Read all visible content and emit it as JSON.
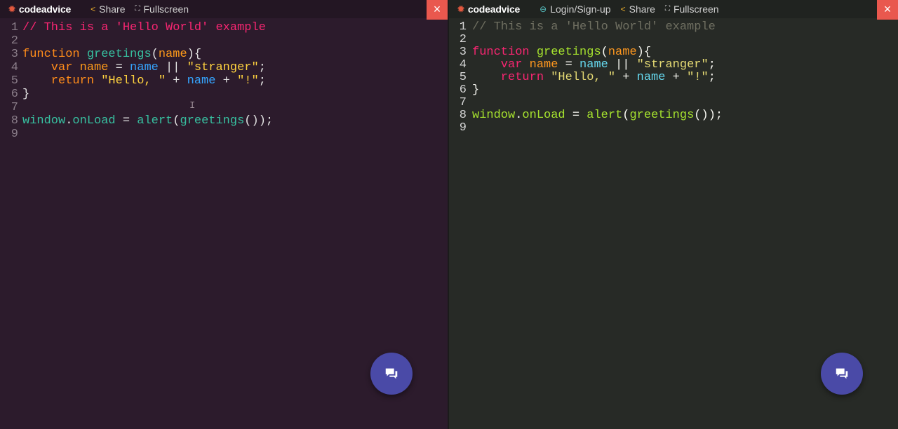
{
  "left": {
    "nav": {
      "brand": "codeadvice",
      "share": "Share",
      "fullscreen": "Fullscreen",
      "close": "×"
    },
    "lines": [
      {
        "n": "1",
        "tokens": [
          {
            "t": "// This is a 'Hello World' example",
            "c": "#f92672"
          }
        ]
      },
      {
        "n": "2",
        "tokens": []
      },
      {
        "n": "3",
        "tokens": [
          {
            "t": "function ",
            "c": "#ff8c1a"
          },
          {
            "t": "greetings",
            "c": "#37c0a0"
          },
          {
            "t": "(",
            "c": "#e3e3e3"
          },
          {
            "t": "name",
            "c": "#ff9b1a"
          },
          {
            "t": "){",
            "c": "#e3e3e3"
          }
        ]
      },
      {
        "n": "4",
        "tokens": [
          {
            "t": "    var ",
            "c": "#ff8c1a"
          },
          {
            "t": "name",
            "c": "#ff9b1a"
          },
          {
            "t": " = ",
            "c": "#e3e3e3"
          },
          {
            "t": "name",
            "c": "#35a5ff"
          },
          {
            "t": " || ",
            "c": "#e3e3e3"
          },
          {
            "t": "\"stranger\"",
            "c": "#ffd23f"
          },
          {
            "t": ";",
            "c": "#e3e3e3"
          }
        ]
      },
      {
        "n": "5",
        "tokens": [
          {
            "t": "    return ",
            "c": "#ff8c1a"
          },
          {
            "t": "\"Hello, \"",
            "c": "#ffd23f"
          },
          {
            "t": " + ",
            "c": "#e3e3e3"
          },
          {
            "t": "name",
            "c": "#35a5ff"
          },
          {
            "t": " + ",
            "c": "#e3e3e3"
          },
          {
            "t": "\"!\"",
            "c": "#ffd23f"
          },
          {
            "t": ";",
            "c": "#e3e3e3"
          }
        ]
      },
      {
        "n": "6",
        "tokens": [
          {
            "t": "}",
            "c": "#e3e3e3"
          }
        ]
      },
      {
        "n": "7",
        "tokens": []
      },
      {
        "n": "8",
        "tokens": [
          {
            "t": "window",
            "c": "#37c0a0"
          },
          {
            "t": ".",
            "c": "#e3e3e3"
          },
          {
            "t": "onLoad",
            "c": "#37c0a0"
          },
          {
            "t": " = ",
            "c": "#e3e3e3"
          },
          {
            "t": "alert",
            "c": "#37c0a0"
          },
          {
            "t": "(",
            "c": "#e3e3e3"
          },
          {
            "t": "greetings",
            "c": "#37c0a0"
          },
          {
            "t": "());",
            "c": "#e3e3e3"
          }
        ]
      },
      {
        "n": "9",
        "tokens": []
      }
    ]
  },
  "right": {
    "nav": {
      "brand": "codeadvice",
      "login": "Login/Sign-up",
      "share": "Share",
      "fullscreen": "Fullscreen",
      "close": "×"
    },
    "lines": [
      {
        "n": "1",
        "tokens": [
          {
            "t": "// This is a 'Hello World' example",
            "c": "#6f6f61"
          }
        ]
      },
      {
        "n": "2",
        "tokens": []
      },
      {
        "n": "3",
        "tokens": [
          {
            "t": "function ",
            "c": "#f92672"
          },
          {
            "t": "greetings",
            "c": "#a6e22e"
          },
          {
            "t": "(",
            "c": "#f8f8f2"
          },
          {
            "t": "name",
            "c": "#fd971f"
          },
          {
            "t": "){",
            "c": "#f8f8f2"
          }
        ]
      },
      {
        "n": "4",
        "tokens": [
          {
            "t": "    var ",
            "c": "#f92672"
          },
          {
            "t": "name",
            "c": "#fd971f"
          },
          {
            "t": " = ",
            "c": "#f8f8f2"
          },
          {
            "t": "name",
            "c": "#66d9ef"
          },
          {
            "t": " || ",
            "c": "#f8f8f2"
          },
          {
            "t": "\"stranger\"",
            "c": "#e6db74"
          },
          {
            "t": ";",
            "c": "#f8f8f2"
          }
        ]
      },
      {
        "n": "5",
        "tokens": [
          {
            "t": "    return ",
            "c": "#f92672"
          },
          {
            "t": "\"Hello, \"",
            "c": "#e6db74"
          },
          {
            "t": " + ",
            "c": "#f8f8f2"
          },
          {
            "t": "name",
            "c": "#66d9ef"
          },
          {
            "t": " + ",
            "c": "#f8f8f2"
          },
          {
            "t": "\"!\"",
            "c": "#e6db74"
          },
          {
            "t": ";",
            "c": "#f8f8f2"
          }
        ]
      },
      {
        "n": "6",
        "tokens": [
          {
            "t": "}",
            "c": "#f8f8f2"
          }
        ]
      },
      {
        "n": "7",
        "tokens": []
      },
      {
        "n": "8",
        "tokens": [
          {
            "t": "window",
            "c": "#a6e22e"
          },
          {
            "t": ".",
            "c": "#f8f8f2"
          },
          {
            "t": "onLoad",
            "c": "#a6e22e"
          },
          {
            "t": " = ",
            "c": "#f8f8f2"
          },
          {
            "t": "alert",
            "c": "#a6e22e"
          },
          {
            "t": "(",
            "c": "#f8f8f2"
          },
          {
            "t": "greetings",
            "c": "#a6e22e"
          },
          {
            "t": "());",
            "c": "#f8f8f2"
          }
        ]
      },
      {
        "n": "9",
        "tokens": []
      }
    ]
  },
  "colors": {
    "close_button": "#e9584e",
    "chat_button": "#4a4aa7"
  }
}
